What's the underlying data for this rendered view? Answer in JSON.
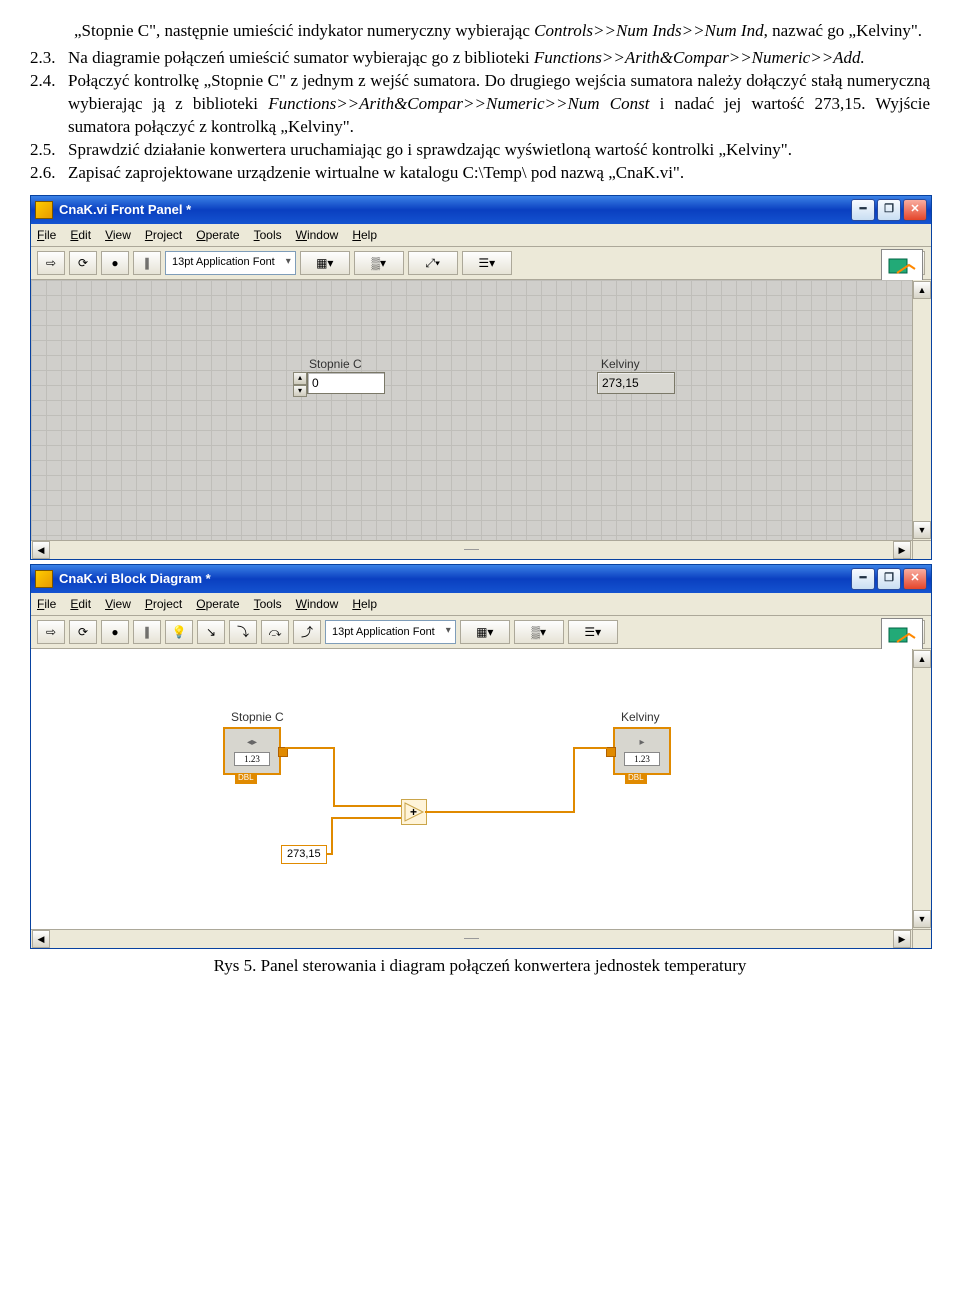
{
  "doc": {
    "p1a": "„Stopnie C\", następnie umieścić indykator numeryczny wybierając ",
    "p1b": "Controls>>Num Inds>>Num Ind",
    "p1c": ", nazwać go „Kelviny\".",
    "items": [
      {
        "num": "2.3.",
        "a": "Na diagramie połączeń umieścić sumator wybierając go z biblioteki ",
        "b": "Functions>>Arith&Compar>>Numeric>>Add.",
        "c": ""
      },
      {
        "num": "2.4.",
        "a": "Połączyć kontrolkę „Stopnie C\" z jednym z wejść sumatora. Do drugiego wejścia sumatora należy dołączyć stałą numeryczną wybierając ją z biblioteki ",
        "b": "Functions>>Arith&Compar>>Numeric>>Num Const",
        "c": " i nadać jej wartość 273,15. Wyjście sumatora połączyć z kontrolką „Kelviny\"."
      },
      {
        "num": "2.5.",
        "a": "Sprawdzić działanie konwertera uruchamiając go i sprawdzając wyświetloną wartość kontrolki „Kelviny\".",
        "b": "",
        "c": ""
      },
      {
        "num": "2.6.",
        "a": "Zapisać zaprojektowane urządzenie wirtualne w katalogu C:\\Temp\\ pod nazwą „CnaK.vi\".",
        "b": "",
        "c": ""
      }
    ]
  },
  "panel": {
    "title": "CnaK.vi Front Panel *",
    "menus": [
      "File",
      "Edit",
      "View",
      "Project",
      "Operate",
      "Tools",
      "Window",
      "Help"
    ],
    "font": "13pt Application Font",
    "control_label": "Stopnie C",
    "control_value": "0",
    "indicator_label": "Kelviny",
    "indicator_value": "273,15",
    "icon_count": "1"
  },
  "diagram": {
    "title": "CnaK.vi Block Diagram *",
    "menus": [
      "File",
      "Edit",
      "View",
      "Project",
      "Operate",
      "Tools",
      "Window",
      "Help"
    ],
    "font": "13pt Application Font",
    "control_label": "Stopnie C",
    "indicator_label": "Kelviny",
    "node_val": "1.23",
    "dbl": "DBL",
    "const_value": "273,15",
    "add_symbol": "+",
    "icon_count": "1"
  },
  "caption": "Rys 5. Panel sterowania i diagram połączeń konwertera jednostek temperatury"
}
